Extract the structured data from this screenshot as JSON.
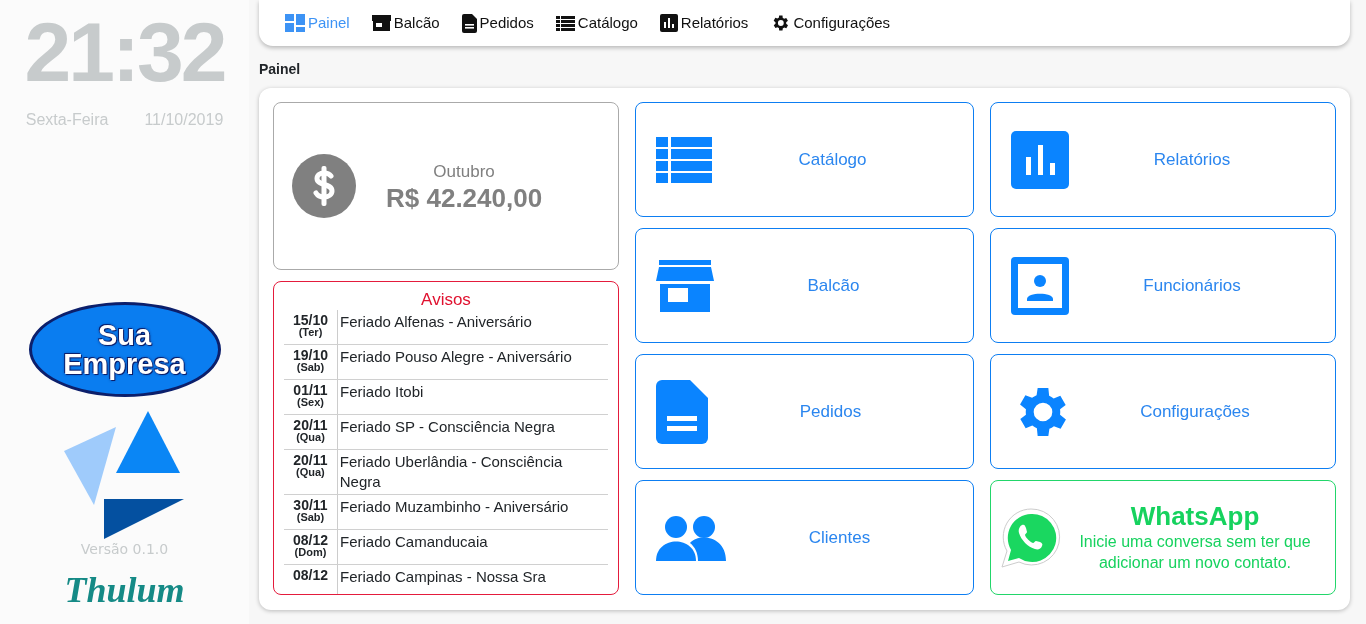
{
  "sidebar": {
    "clock": "21:32",
    "weekday": "Sexta-Feira",
    "date": "11/10/2019",
    "company_logo": {
      "line_1": "Sua",
      "line_2": "Empresa"
    },
    "version": "Versão 0.1.0",
    "brand": "Thulum"
  },
  "nav": [
    {
      "label": "Painel",
      "selected": true
    },
    {
      "label": "Balcão",
      "selected": false
    },
    {
      "label": "Pedidos",
      "selected": false
    },
    {
      "label": "Catálogo",
      "selected": false
    },
    {
      "label": "Relatórios",
      "selected": false
    },
    {
      "label": "Configurações",
      "selected": false
    }
  ],
  "page_title": "Painel",
  "summary": {
    "month": "Outubro",
    "amount": "R$ 42.240,00"
  },
  "notices": {
    "title": "Avisos",
    "items": [
      {
        "date": "15/10",
        "day": "(Ter)",
        "text": "Feriado Alfenas - Aniversário"
      },
      {
        "date": "19/10",
        "day": "(Sab)",
        "text": "Feriado Pouso Alegre - Aniversário"
      },
      {
        "date": "01/11",
        "day": "(Sex)",
        "text": "Feriado Itobi"
      },
      {
        "date": "20/11",
        "day": "(Qua)",
        "text": "Feriado SP - Consciência Negra"
      },
      {
        "date": "20/11",
        "day": "(Qua)",
        "text": "Feriado Uberlândia - Consciência Negra"
      },
      {
        "date": "30/11",
        "day": "(Sab)",
        "text": "Feriado Muzambinho - Aniversário"
      },
      {
        "date": "08/12",
        "day": "(Dom)",
        "text": "Feriado Camanducaia"
      },
      {
        "date": "08/12",
        "text": "Feriado Campinas - Nossa Sra"
      }
    ]
  },
  "tiles": [
    {
      "kind": "menu",
      "label": "Catálogo"
    },
    {
      "kind": "menu",
      "label": "Relatórios"
    },
    {
      "kind": "menu",
      "label": "Balcão"
    },
    {
      "kind": "menu",
      "label": "Funcionários"
    },
    {
      "kind": "menu",
      "label": "Pedidos"
    },
    {
      "kind": "menu",
      "label": "Configurações"
    },
    {
      "kind": "menu",
      "label": "Clientes"
    }
  ],
  "whatsapp": {
    "title": "WhatsApp",
    "text": "Inicie uma conversa sem ter que adicionar um novo contato."
  }
}
